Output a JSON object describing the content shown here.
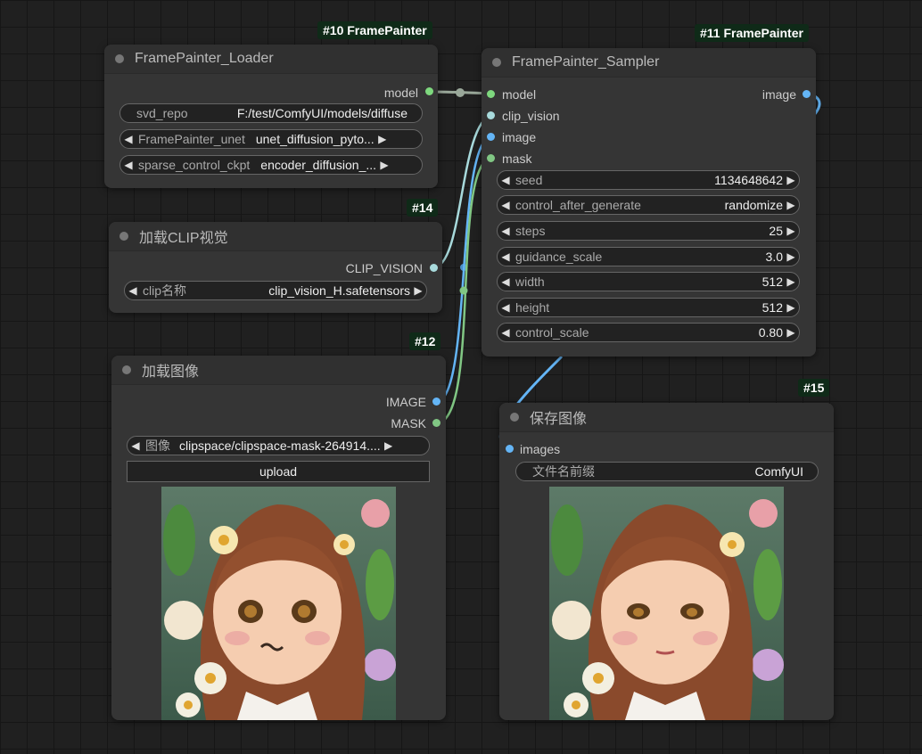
{
  "colors": {
    "background": "#202020",
    "node_bg": "#353535",
    "model_port": "#7ed87e",
    "image_port": "#64b5f6",
    "clip_port": "#a8dadc",
    "mask_port": "#81c784"
  },
  "nodes": {
    "loader": {
      "badge": "#10 FramePainter",
      "title": "FramePainter_Loader",
      "output_model": "model",
      "svd_repo_label": "svd_repo",
      "svd_repo_value": "F:/test/ComfyUI/models/diffuse",
      "unet_label": "FramePainter_unet",
      "unet_value": "unet_diffusion_pyto...",
      "ckpt_label": "sparse_control_ckpt",
      "ckpt_value": "encoder_diffusion_..."
    },
    "clip": {
      "badge": "#14",
      "title": "加载CLIP视觉",
      "output": "CLIP_VISION",
      "clip_label": "clip名称",
      "clip_value": "clip_vision_H.safetensors"
    },
    "load_image": {
      "badge": "#12",
      "title": "加载图像",
      "output_image": "IMAGE",
      "output_mask": "MASK",
      "image_label": "图像",
      "image_value": "clipspace/clipspace-mask-264914....",
      "upload_label": "upload"
    },
    "sampler": {
      "badge": "#11 FramePainter",
      "title": "FramePainter_Sampler",
      "inputs": [
        "model",
        "clip_vision",
        "image",
        "mask"
      ],
      "output_image": "image",
      "widgets": [
        {
          "label": "seed",
          "value": "1134648642"
        },
        {
          "label": "control_after_generate",
          "value": "randomize"
        },
        {
          "label": "steps",
          "value": "25"
        },
        {
          "label": "guidance_scale",
          "value": "3.0"
        },
        {
          "label": "width",
          "value": "512"
        },
        {
          "label": "height",
          "value": "512"
        },
        {
          "label": "control_scale",
          "value": "0.80"
        }
      ]
    },
    "save": {
      "badge": "#15",
      "title": "保存图像",
      "input_images": "images",
      "prefix_label": "文件名前缀",
      "prefix_value": "ComfyUI"
    }
  }
}
